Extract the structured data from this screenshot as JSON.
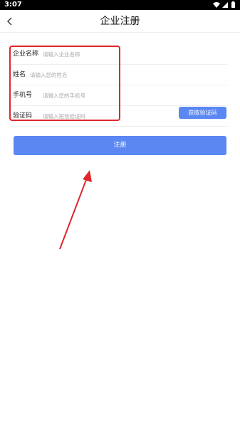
{
  "status_bar": {
    "time": "3:07",
    "icons": [
      "wifi-icon",
      "signal-icon",
      "battery-icon"
    ]
  },
  "header": {
    "back_icon": "chevron-left-icon",
    "title": "企业注册"
  },
  "form": {
    "company": {
      "label": "企业名称",
      "placeholder": "请输入企业名称",
      "value": ""
    },
    "name": {
      "label": "姓名",
      "placeholder": "请输入您的姓名",
      "value": ""
    },
    "phone": {
      "label": "手机号",
      "placeholder": "请输入您的手机号",
      "value": ""
    },
    "code": {
      "label": "验证码",
      "placeholder": "请输入短信验证码",
      "value": ""
    },
    "get_code_label": "获取验证码",
    "submit_label": "注册"
  },
  "annotation": {
    "highlight_color": "#e0262b",
    "arrow_color": "#e0262b"
  },
  "colors": {
    "accent": "#5b87f2",
    "status_bar_bg": "#000000",
    "background": "#ffffff"
  }
}
